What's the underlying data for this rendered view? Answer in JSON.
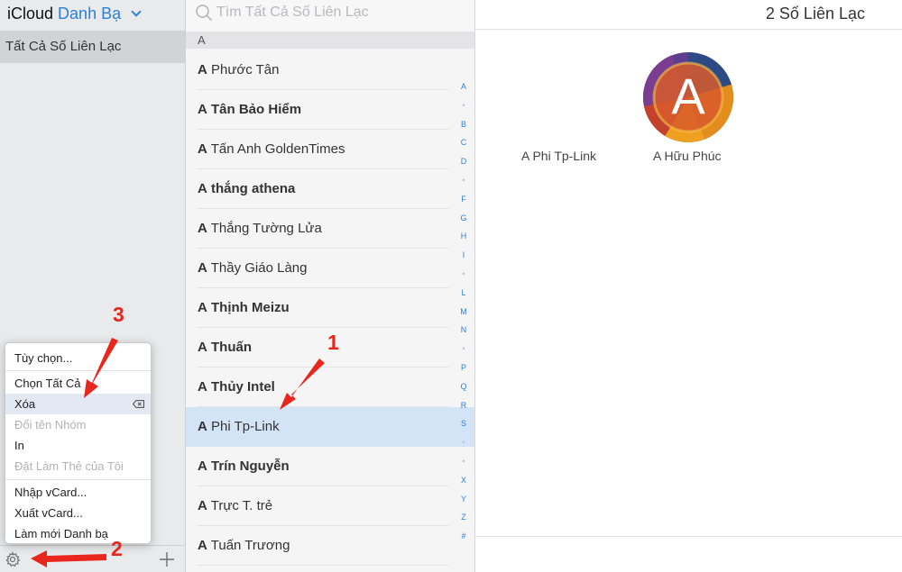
{
  "app": {
    "brand": "iCloud",
    "section": "Danh Bạ"
  },
  "sidebar": {
    "groups": [
      {
        "label": "Tất Cả Số Liên Lạc",
        "selected": true
      }
    ]
  },
  "menu": {
    "items": [
      {
        "label": "Tùy chọn...",
        "enabled": true
      },
      {
        "label": "Chọn Tất Cả",
        "enabled": true
      },
      {
        "label": "Xóa",
        "enabled": true,
        "highlighted": true,
        "shortcut_icon": "delete-key-icon"
      },
      {
        "label": "Đổi tên Nhóm",
        "enabled": false
      },
      {
        "label": "In",
        "enabled": true
      },
      {
        "label": "Đặt Làm Thẻ của Tôi",
        "enabled": false
      },
      {
        "label": "Nhập vCard...",
        "enabled": true
      },
      {
        "label": "Xuất vCard...",
        "enabled": true
      },
      {
        "label": "Làm mới Danh bạ",
        "enabled": true
      }
    ]
  },
  "search": {
    "placeholder": "Tìm Tất Cả Số Liên Lạc"
  },
  "list": {
    "section_letter": "A",
    "contacts": [
      {
        "first": "A",
        "last": "Phước Tân",
        "last_bold": false,
        "selected": false
      },
      {
        "first": "A",
        "last": "Tân Bảo Hiểm",
        "last_bold": true,
        "selected": false
      },
      {
        "first": "A",
        "last": "Tấn Anh GoldenTimes",
        "last_bold": false,
        "selected": false
      },
      {
        "first": "A",
        "last": "thắng athena",
        "last_bold": true,
        "selected": false
      },
      {
        "first": "A",
        "last": "Thắng Tường Lửa",
        "last_bold": false,
        "selected": false
      },
      {
        "first": "A",
        "last": "Thầy Giáo Làng",
        "last_bold": false,
        "selected": false
      },
      {
        "first": "A",
        "last": "Thịnh Meizu",
        "last_bold": true,
        "selected": false
      },
      {
        "first": "A",
        "last": "Thuấn",
        "last_bold": true,
        "selected": false
      },
      {
        "first": "A",
        "last": "Thủy Intel",
        "last_bold": true,
        "selected": false
      },
      {
        "first": "A",
        "last": "Phi Tp-Link",
        "last_bold": false,
        "selected": true
      },
      {
        "first": "A",
        "last": "Trín Nguyễn",
        "last_bold": true,
        "selected": false
      },
      {
        "first": "A",
        "last": "Trực T. trẻ",
        "last_bold": false,
        "selected": false
      },
      {
        "first": "A",
        "last": "Tuấn Trương",
        "last_bold": false,
        "selected": false
      }
    ],
    "index_letters": [
      "A",
      "•",
      "B",
      "C",
      "D",
      "•",
      "F",
      "G",
      "H",
      "I",
      "•",
      "L",
      "M",
      "N",
      "•",
      "P",
      "Q",
      "R",
      "S",
      "•",
      "•",
      "X",
      "Y",
      "Z",
      "#"
    ]
  },
  "detail": {
    "count_label": "2 Số Liên Lạc",
    "avatar_letter": "A",
    "cards": [
      {
        "name": "A Phi Tp-Link"
      },
      {
        "name": "A Hữu Phúc"
      }
    ]
  },
  "annotations": {
    "step1": "1",
    "step2": "2",
    "step3": "3"
  },
  "colors": {
    "accent": "#2d7fd8",
    "annotation": "#e8261b",
    "selection": "#d4e4f7"
  }
}
